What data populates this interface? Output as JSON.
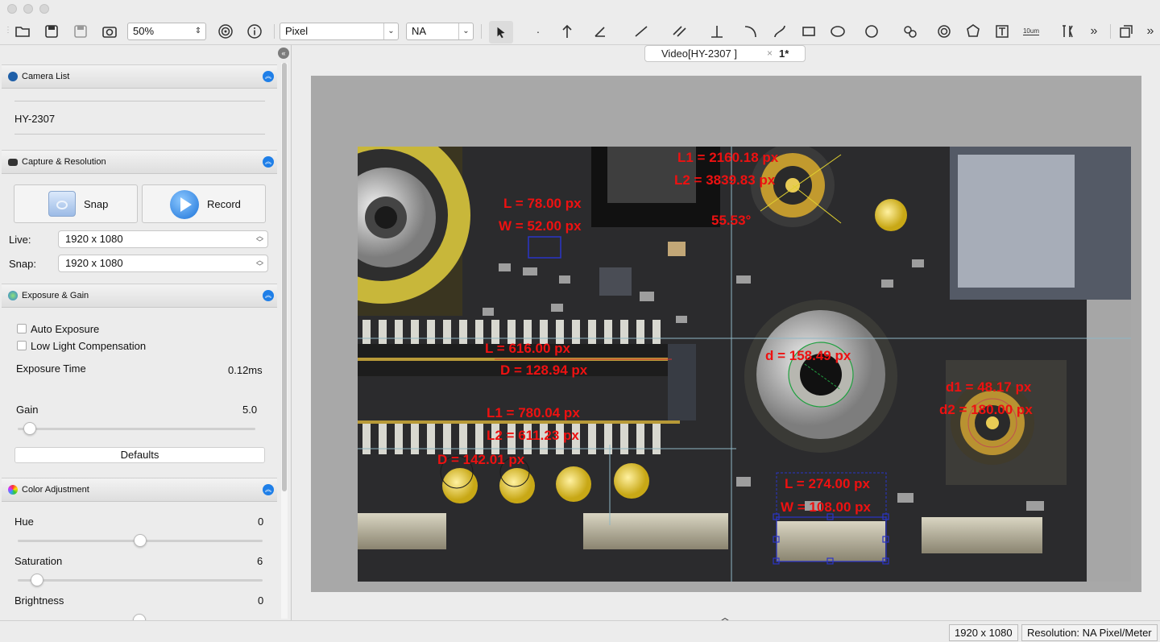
{
  "toolbar": {
    "zoom_value": "50%",
    "unit_select": "Pixel",
    "calibration_select": "NA",
    "scale_bar_label": "10um"
  },
  "panel": {
    "camera_list": {
      "title": "Camera List",
      "camera_name": "HY-2307"
    },
    "capture": {
      "title": "Capture & Resolution",
      "snap_label": "Snap",
      "record_label": "Record",
      "live_label": "Live:",
      "live_value": "1920 x 1080",
      "snap_res_label": "Snap:",
      "snap_res_value": "1920 x 1080"
    },
    "exposure": {
      "title": "Exposure & Gain",
      "auto_exposure": "Auto Exposure",
      "low_light": "Low Light Compensation",
      "exposure_time_label": "Exposure Time",
      "exposure_time_value": "0.12ms",
      "gain_label": "Gain",
      "gain_value": "5.0",
      "gain_level": 0.05,
      "defaults_label": "Defaults"
    },
    "color": {
      "title": "Color Adjustment",
      "hue_label": "Hue",
      "hue_value": "0",
      "hue_level": 0.5,
      "saturation_label": "Saturation",
      "saturation_value": "6",
      "saturation_level": 0.08,
      "brightness_label": "Brightness",
      "brightness_value": "0"
    }
  },
  "tab": {
    "title": "Video[HY-2307 ]",
    "doc_label": "1*"
  },
  "measurements": {
    "m1": "L1 = 2160.18 px",
    "m2": "L2 = 3839.83 px",
    "m3": "55.53°",
    "m4": "L = 78.00 px",
    "m5": "W = 52.00 px",
    "m6": "L = 616.00 px",
    "m7": "D = 128.94 px",
    "m8": "d = 158.49 px",
    "m9": "d1 = 48.17 px",
    "m10": "d2 = 180.00 px",
    "m11": "L1 = 780.04 px",
    "m12": "L2 = 611.23 px",
    "m13": "D = 142.01 px",
    "m14": "L = 274.00 px",
    "m15": "W = 108.00 px"
  },
  "status": {
    "resolution": "1920 x 1080",
    "calibration": "Resolution: NA Pixel/Meter"
  }
}
